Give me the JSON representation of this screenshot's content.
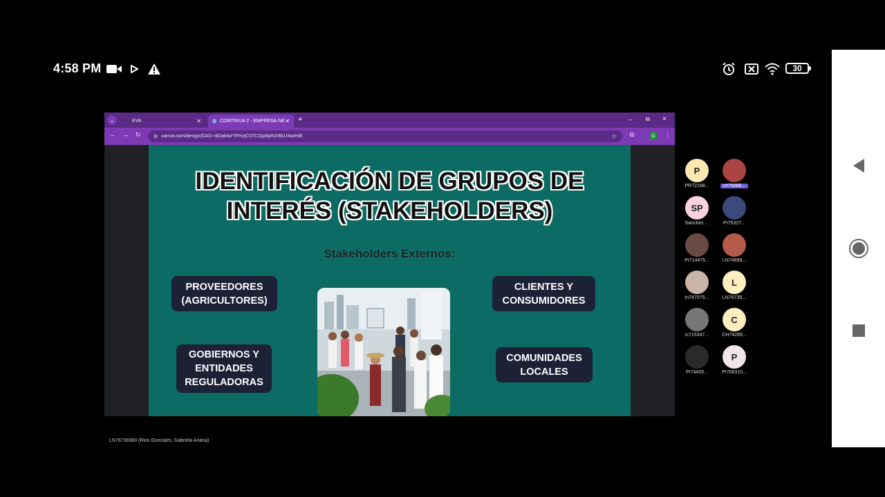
{
  "status_bar": {
    "time": "4:58 PM",
    "battery": "30",
    "left_icons": [
      "video-camera-icon",
      "play-arrow-icon",
      "warning-icon"
    ],
    "right_icons": [
      "alarm-icon",
      "close-box-icon",
      "wifi-icon",
      "battery-icon"
    ]
  },
  "browser": {
    "tabs": [
      {
        "label": "EVA",
        "active": false
      },
      {
        "label": "CONTINUA 2 - EMPRESA NEST...",
        "active": true
      }
    ],
    "new_tab": "+",
    "window_controls": [
      "–",
      "⧉",
      "×"
    ],
    "url": "canva.com/design/DAG-ntDaklw/YFHzjC5TCGpblpNX8b1I4w/edit",
    "profile_initial": "G"
  },
  "slide": {
    "title_line1": "IDENTIFICACIÓN DE GRUPOS DE",
    "title_line2": "INTERÉS (STAKEHOLDERS)",
    "subtitle": "Stakeholders Externos:",
    "boxes": {
      "proveedores_1": "PROVEEDORES",
      "proveedores_2": "(AGRICULTORES)",
      "clientes_1": "CLIENTES Y",
      "clientes_2": "CONSUMIDORES",
      "gobiernos_1": "GOBIERNOS Y",
      "gobiernos_2": "ENTIDADES",
      "gobiernos_3": "REGULADORAS",
      "comunidades_1": "COMUNIDADES",
      "comunidades_2": "LOCALES"
    }
  },
  "participants": [
    {
      "initials": "P",
      "name": "PR72168...",
      "color": "#fde7b0"
    },
    {
      "initials": "",
      "name": "ch75888...",
      "color": "#a44",
      "selected": true
    },
    {
      "initials": "SP",
      "name": "Sanchez ...",
      "color": "#fbd3e0"
    },
    {
      "initials": "",
      "name": "PI75327...",
      "color": "#3a4a7a"
    },
    {
      "initials": "",
      "name": "PI714475...",
      "color": "#6a4a44"
    },
    {
      "initials": "",
      "name": "LN74699...",
      "color": "#b35a4a"
    },
    {
      "initials": "",
      "name": "ln747075...",
      "color": "#c9b5a8"
    },
    {
      "initials": "L",
      "name": "LN76739...",
      "color": "#fdeec0"
    },
    {
      "initials": "",
      "name": "ic715347...",
      "color": "#777"
    },
    {
      "initials": "C",
      "name": "CH74289...",
      "color": "#fdeec0"
    },
    {
      "initials": "",
      "name": "PI74405...",
      "color": "#2a2a2a"
    },
    {
      "initials": "P",
      "name": "PI706310...",
      "color": "#f2e6ea"
    }
  ],
  "footer": {
    "presenter": "LN76739360 (Rios Gonzales, Gabriela Ariana)"
  }
}
